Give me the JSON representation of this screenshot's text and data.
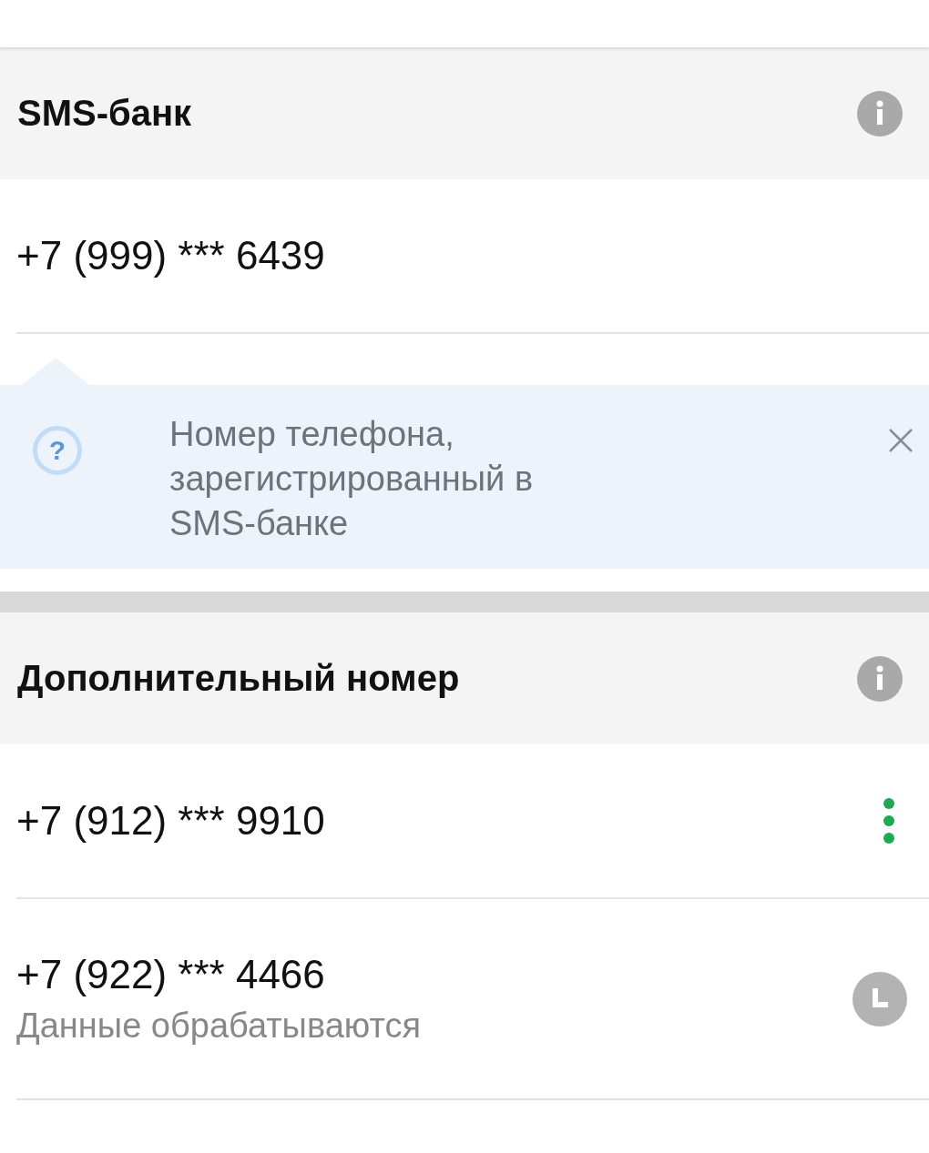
{
  "sections": [
    {
      "title": "SMS-банк",
      "rows": [
        {
          "kind": "plain",
          "phone": "+7 (999) *** 6439"
        }
      ],
      "hint": {
        "icon": "?",
        "text": "Номер телефона, зарегистрированный в SMS-банке"
      }
    },
    {
      "title": "Дополнительный номер",
      "rows": [
        {
          "kind": "menu",
          "phone": "+7 (912) *** 9910"
        },
        {
          "kind": "pending",
          "phone": "+7 (922) *** 4466",
          "status": "Данные обрабатываются"
        }
      ]
    }
  ]
}
